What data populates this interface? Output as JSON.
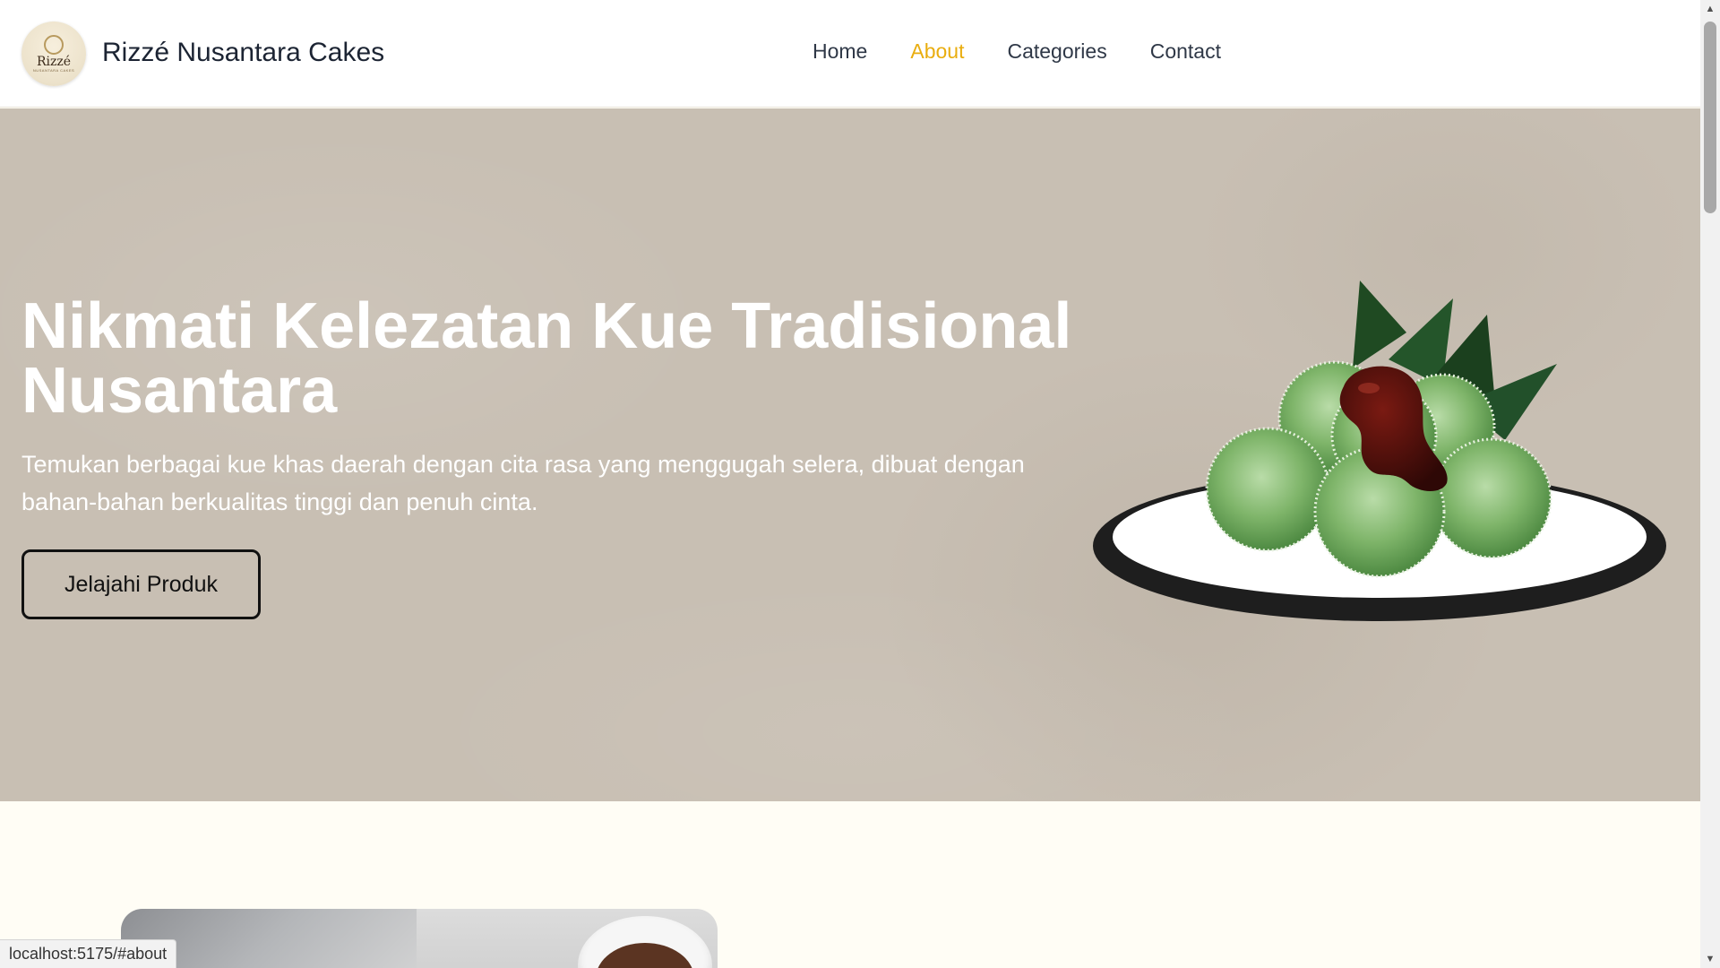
{
  "header": {
    "logo": {
      "text": "Rizzé",
      "subtext": "NUSANTARA CAKES"
    },
    "brand_name": "Rizzé Nusantara Cakes",
    "nav": [
      {
        "label": "Home",
        "active": false
      },
      {
        "label": "About",
        "active": true
      },
      {
        "label": "Categories",
        "active": false
      },
      {
        "label": "Contact",
        "active": false
      }
    ]
  },
  "hero": {
    "title": "Nikmati Kelezatan Kue Tradisional Nusantara",
    "subtitle": "Temukan berbagai kue khas daerah dengan cita rasa yang menggugah selera, dibuat dengan bahan-bahan berkualitas tinggi dan penuh cinta.",
    "cta_label": "Jelajahi Produk"
  },
  "statusbar": {
    "url": "localhost:5175/#about"
  },
  "colors": {
    "accent_active_nav": "#e9ad0f",
    "hero_bg": "#c8bfb3",
    "page_bg": "#fffdf5",
    "text_dark": "#1c2433"
  },
  "icons": {
    "scroll_up": "▲",
    "scroll_down": "▼"
  }
}
